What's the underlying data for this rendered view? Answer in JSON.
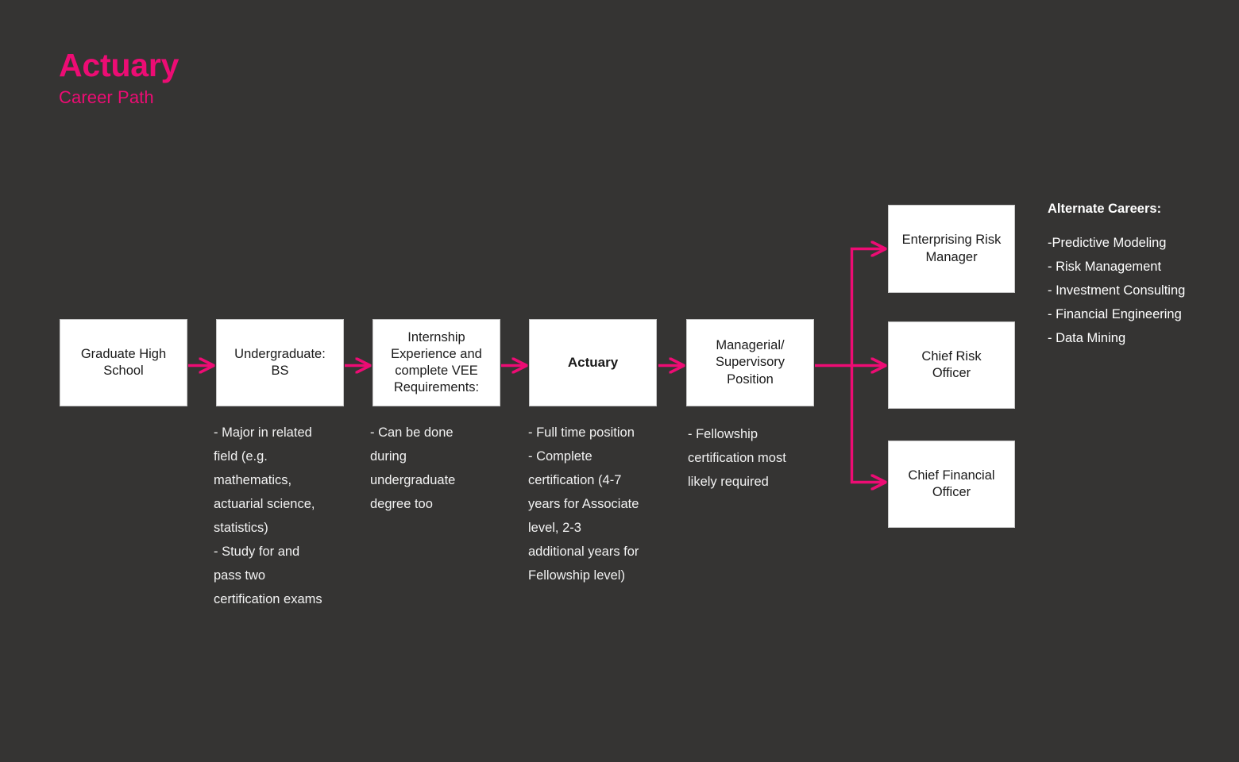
{
  "header": {
    "title": "Actuary",
    "subtitle": "Career Path"
  },
  "colors": {
    "background": "#353433",
    "accent_pink": "#ED0C74",
    "box_fill": "#FFFFFF",
    "box_border": "#C8C8C8",
    "note_text": "#F2F2F2"
  },
  "flow": {
    "boxes": [
      {
        "id": "graduate-high-school",
        "label": "Graduate High\nSchool",
        "emphasis": false
      },
      {
        "id": "undergraduate-bs",
        "label": "Undergraduate:\nBS",
        "emphasis": false
      },
      {
        "id": "internship-vee",
        "label": "Internship\nExperience and\ncomplete VEE\nRequirements:",
        "emphasis": false
      },
      {
        "id": "actuary",
        "label": "Actuary",
        "emphasis": true
      },
      {
        "id": "managerial-supervisory",
        "label": "Managerial/\nSupervisory\nPosition",
        "emphasis": false
      },
      {
        "id": "enterprising-risk-manager",
        "label": "Enterprising Risk\nManager",
        "emphasis": false
      },
      {
        "id": "chief-risk-officer",
        "label": "Chief Risk\nOfficer",
        "emphasis": false
      },
      {
        "id": "chief-financial-officer",
        "label": "Chief Financial\nOfficer",
        "emphasis": false
      }
    ],
    "notes": [
      {
        "id": "note-undergraduate",
        "text": "- Major in related\nfield (e.g.\nmathematics,\nactuarial science,\nstatistics)\n- Study for and\npass two\ncertification exams"
      },
      {
        "id": "note-internship",
        "text": "- Can be done\nduring\nundergraduate\ndegree too"
      },
      {
        "id": "note-actuary",
        "text": "- Full time position\n- Complete\ncertification (4-7\nyears for Associate\nlevel, 2-3\nadditional years for\nFellowship level)"
      },
      {
        "id": "note-managerial",
        "text": "- Fellowship\ncertification most\nlikely required"
      }
    ]
  },
  "alternate_careers": {
    "title": "Alternate Careers:",
    "items": [
      "-Predictive Modeling",
      "- Risk Management",
      "- Investment Consulting",
      "- Financial Engineering",
      "- Data Mining"
    ]
  }
}
